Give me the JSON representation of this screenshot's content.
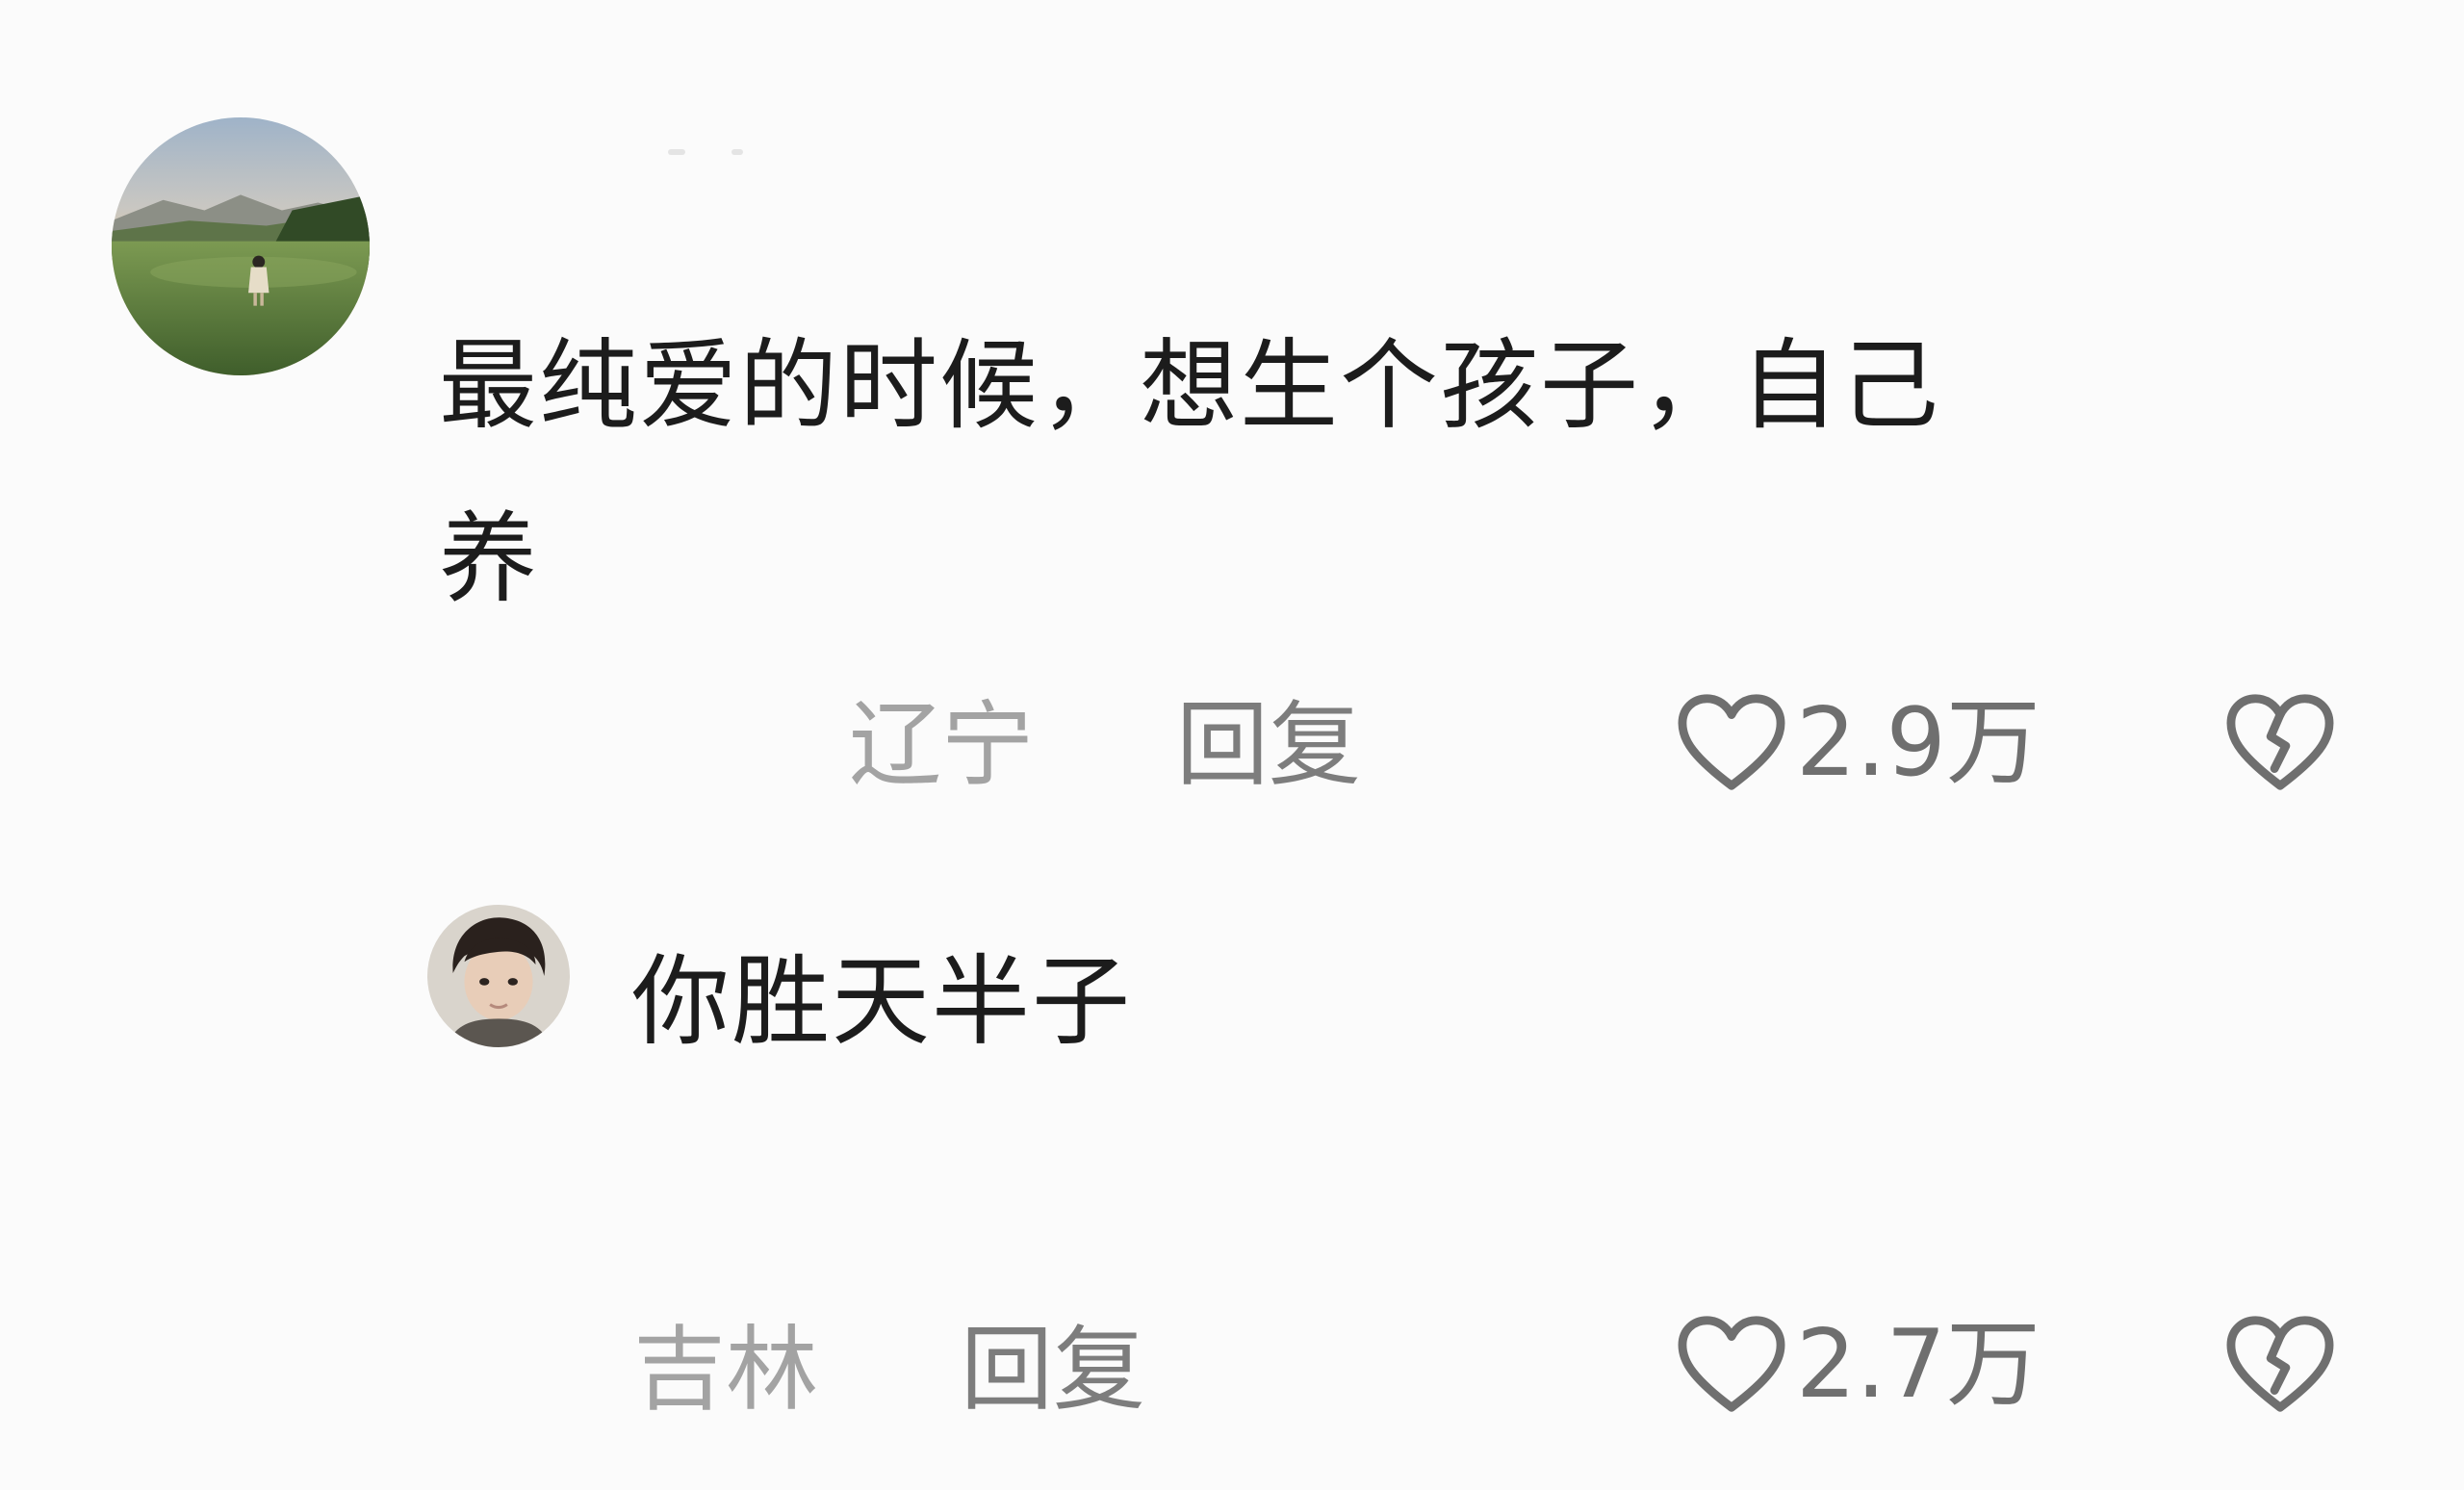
{
  "comments": [
    {
      "text_line1": "最纯爱的时候，想生个孩子，自己",
      "text_line2": "养",
      "location": "辽宁",
      "reply_label": "回复",
      "likes": "2.9万",
      "avatar_icon": "landscape-avatar"
    },
    {
      "text_line1": "你胜天半子",
      "location": "吉林",
      "reply_label": "回复",
      "likes": "2.7万",
      "avatar_icon": "boy-portrait-avatar"
    }
  ],
  "icons": {
    "like": "heart-outline-icon",
    "dislike": "broken-heart-icon"
  },
  "colors": {
    "background": "#fbfbfb",
    "text": "#1c1c1c",
    "meta": "#a3a3a3",
    "icon": "#6f6f6f"
  }
}
